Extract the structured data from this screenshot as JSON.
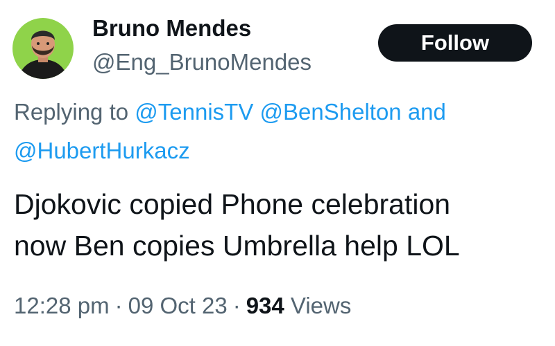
{
  "author": {
    "name": "Bruno Mendes",
    "handle": "@Eng_BrunoMendes",
    "avatar_icon": "profile-photo",
    "avatar_bg": "#8fd34a"
  },
  "follow_button": {
    "label": "Follow",
    "bg": "#0f1419",
    "color": "#ffffff"
  },
  "reply": {
    "prefix": "Replying to",
    "mentions": [
      "@TennisTV",
      "@BenShelton",
      "@HubertHurkacz"
    ],
    "conjunction": "and",
    "mention_color": "#1d9bf0"
  },
  "tweet": {
    "lines": [
      "Djokovic copied Phone celebration",
      "now Ben copies Umbrella help LOL"
    ]
  },
  "meta": {
    "time": "12:28 pm",
    "separator": "·",
    "date": "09 Oct 23",
    "views_count": "934",
    "views_label": "Views"
  }
}
